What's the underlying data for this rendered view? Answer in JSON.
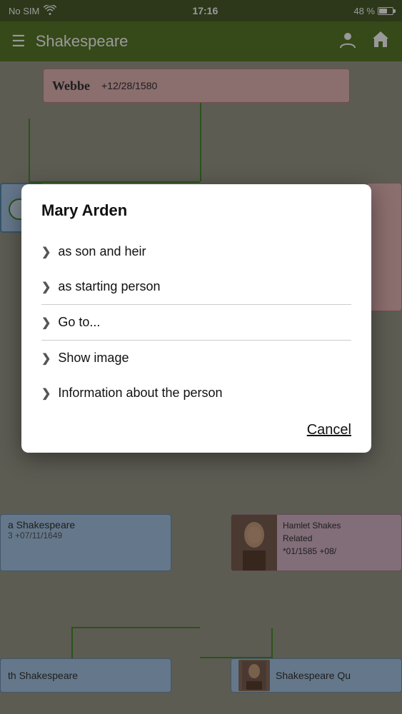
{
  "statusBar": {
    "carrier": "No SIM",
    "time": "17:16",
    "battery": "48 %"
  },
  "navBar": {
    "title": "Shakespeare",
    "menuIcon": "☰",
    "userIcon": "👤",
    "homeIcon": "🏠"
  },
  "bgCards": {
    "webbeCard": {
      "name": "Webbe",
      "date": "+12/28/1580"
    },
    "bottomLeftCard": {
      "line1": "a Shakespeare",
      "line2": "3   +07/11/1649"
    },
    "bottomRightCard": {
      "label": "Related",
      "birth": "*01/1585",
      "death": "+08/",
      "name": "Hamlet Shakes"
    },
    "bottomRowLeft": {
      "text": "th Shakespeare"
    },
    "bottomRowRight": {
      "text": "Shakespeare Qu"
    }
  },
  "modal": {
    "title": "Mary Arden",
    "items": [
      {
        "id": "son-heir",
        "label": "as son and heir"
      },
      {
        "id": "starting-person",
        "label": "as starting person"
      },
      {
        "id": "go-to",
        "label": "Go to..."
      },
      {
        "id": "show-image",
        "label": "Show image"
      },
      {
        "id": "info-person",
        "label": "Information about the person"
      }
    ],
    "cancelLabel": "Cancel",
    "chevron": "❯"
  }
}
